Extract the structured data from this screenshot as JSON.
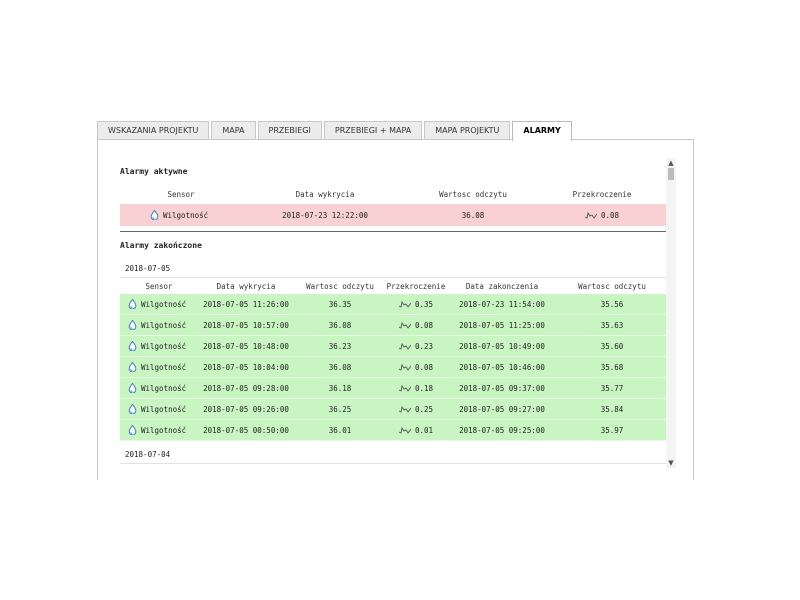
{
  "tabs": [
    {
      "label": "WSKAZANIA PROJEKTU",
      "active": false
    },
    {
      "label": "MAPA",
      "active": false
    },
    {
      "label": "PRZEBIEGI",
      "active": false
    },
    {
      "label": "PRZEBIEGI + MAPA",
      "active": false
    },
    {
      "label": "MAPA PROJEKTU",
      "active": false
    },
    {
      "label": "ALARMY",
      "active": true
    }
  ],
  "active_alarms": {
    "title": "Alarmy aktywne",
    "headers": [
      "Sensor",
      "Data wykrycia",
      "Wartosc odczytu",
      "Przekroczenie"
    ],
    "rows": [
      {
        "sensor": "Wilgotność",
        "detected": "2018-07-23 12:22:00",
        "value": "36.08",
        "exceed": "0.08"
      }
    ]
  },
  "closed_alarms": {
    "title": "Alarmy zakończone",
    "groups": [
      {
        "date": "2018-07-05",
        "headers": [
          "Sensor",
          "Data wykrycia",
          "Wartosc odczytu",
          "Przekroczenie",
          "Data zakonczenia",
          "Wartosc odczytu"
        ],
        "rows": [
          {
            "sensor": "Wilgotność",
            "detected": "2018-07-05 11:26:00",
            "value": "36.35",
            "exceed": "0.35",
            "ended": "2018-07-23 11:54:00",
            "end_value": "35.56"
          },
          {
            "sensor": "Wilgotność",
            "detected": "2018-07-05 10:57:00",
            "value": "36.08",
            "exceed": "0.08",
            "ended": "2018-07-05 11:25:00",
            "end_value": "35.63"
          },
          {
            "sensor": "Wilgotność",
            "detected": "2018-07-05 10:48:00",
            "value": "36.23",
            "exceed": "0.23",
            "ended": "2018-07-05 10:49:00",
            "end_value": "35.60"
          },
          {
            "sensor": "Wilgotność",
            "detected": "2018-07-05 10:04:00",
            "value": "36.08",
            "exceed": "0.08",
            "ended": "2018-07-05 10:46:00",
            "end_value": "35.68"
          },
          {
            "sensor": "Wilgotność",
            "detected": "2018-07-05 09:28:00",
            "value": "36.18",
            "exceed": "0.18",
            "ended": "2018-07-05 09:37:00",
            "end_value": "35.77"
          },
          {
            "sensor": "Wilgotność",
            "detected": "2018-07-05 09:26:00",
            "value": "36.25",
            "exceed": "0.25",
            "ended": "2018-07-05 09:27:00",
            "end_value": "35.84"
          },
          {
            "sensor": "Wilgotność",
            "detected": "2018-07-05 00:50:00",
            "value": "36.01",
            "exceed": "0.01",
            "ended": "2018-07-05 09:25:00",
            "end_value": "35.97"
          }
        ]
      },
      {
        "date": "2018-07-04"
      }
    ]
  },
  "icons": {
    "sensor": "humidity-drop-icon",
    "exceed": "sparkline-icon",
    "scroll_up": "arrow-up-icon",
    "scroll_down": "arrow-down-icon"
  },
  "colors": {
    "active_row": "#f9d0d3",
    "closed_row": "#c9f5c3",
    "drop_icon": "#3a7fc4"
  }
}
